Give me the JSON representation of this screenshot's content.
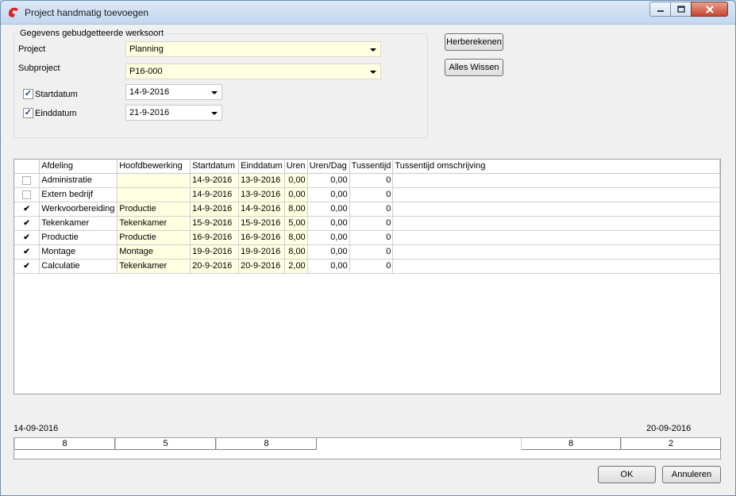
{
  "window": {
    "title": "Project handmatig toevoegen"
  },
  "group": {
    "title": "Gegevens gebudgetteerde werksoort",
    "project_label": "Project",
    "project_value": "Planning",
    "subproject_label": "Subproject",
    "subproject_value": "P16-000",
    "startdatum_label": "Startdatum",
    "startdatum_value": "14-9-2016",
    "startdatum_checked": true,
    "einddatum_label": "Einddatum",
    "einddatum_value": "21-9-2016",
    "einddatum_checked": true
  },
  "buttons": {
    "herberekenen": "Herberekenen",
    "alles_wissen": "Alles Wissen",
    "ok": "OK",
    "annuleren": "Annuleren"
  },
  "grid": {
    "columns": [
      "",
      "Afdeling",
      "Hoofdbewerking",
      "Startdatum",
      "Einddatum",
      "Uren",
      "Uren/Dag",
      "Tussentijd",
      "Tussentijd omschrijving"
    ],
    "rows": [
      {
        "checked": false,
        "afdeling": "Administratie",
        "hoofdbewerking": "",
        "startdatum": "14-9-2016",
        "einddatum": "13-9-2016",
        "uren": "0,00",
        "uren_dag": "0,00",
        "tussentijd": "0",
        "omschrijving": ""
      },
      {
        "checked": false,
        "afdeling": "Extern bedrijf",
        "hoofdbewerking": "",
        "startdatum": "14-9-2016",
        "einddatum": "13-9-2016",
        "uren": "0,00",
        "uren_dag": "0,00",
        "tussentijd": "0",
        "omschrijving": ""
      },
      {
        "checked": true,
        "afdeling": "Werkvoorbereiding",
        "hoofdbewerking": "Productie",
        "startdatum": "14-9-2016",
        "einddatum": "14-9-2016",
        "uren": "8,00",
        "uren_dag": "0,00",
        "tussentijd": "0",
        "omschrijving": ""
      },
      {
        "checked": true,
        "afdeling": "Tekenkamer",
        "hoofdbewerking": "Tekenkamer",
        "startdatum": "15-9-2016",
        "einddatum": "15-9-2016",
        "uren": "5,00",
        "uren_dag": "0,00",
        "tussentijd": "0",
        "omschrijving": ""
      },
      {
        "checked": true,
        "afdeling": "Productie",
        "hoofdbewerking": "Productie",
        "startdatum": "16-9-2016",
        "einddatum": "16-9-2016",
        "uren": "8,00",
        "uren_dag": "0,00",
        "tussentijd": "0",
        "omschrijving": ""
      },
      {
        "checked": true,
        "afdeling": "Montage",
        "hoofdbewerking": "Montage",
        "startdatum": "19-9-2016",
        "einddatum": "19-9-2016",
        "uren": "8,00",
        "uren_dag": "0,00",
        "tussentijd": "0",
        "omschrijving": ""
      },
      {
        "checked": true,
        "afdeling": "Calculatie",
        "hoofdbewerking": "Tekenkamer",
        "startdatum": "20-9-2016",
        "einddatum": "20-9-2016",
        "uren": "2,00",
        "uren_dag": "0,00",
        "tussentijd": "0",
        "omschrijving": ""
      }
    ]
  },
  "timeline": {
    "start_date": "14-09-2016",
    "end_date": "20-09-2016",
    "segments": [
      "8",
      "5",
      "8",
      "8",
      "2"
    ]
  }
}
